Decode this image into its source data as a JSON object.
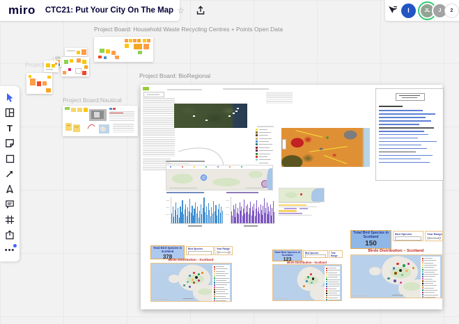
{
  "header": {
    "logo_text": "miro",
    "board_title": "CTC21: Put Your City On The Map",
    "presence_count": "2",
    "avatars": [
      {
        "initials": "I"
      },
      {
        "initials": "JL"
      },
      {
        "initials": "J"
      }
    ]
  },
  "toolbar": {
    "items": [
      "select",
      "templates",
      "text",
      "sticky-note",
      "shape",
      "connection-line",
      "pen",
      "comment",
      "frame",
      "upload",
      "more"
    ]
  },
  "canvas_labels": {
    "household": "Project Board: Household Waste Recycling Centres + Points Open Data",
    "bioregional": "Project Board: BioRegional",
    "nautical": "Project Board:Nautical",
    "ghost": "Project Board:"
  },
  "bird_dashboards": [
    {
      "header": "Total Bird Species in Scotland",
      "count": "378",
      "species_filter": "Bird Species",
      "year_filter": "Year Range",
      "title": "Birds Distribution - Scotland"
    },
    {
      "header": "Total Bird Species in Scotland",
      "count": "123",
      "species_filter": "Bird Species",
      "year_filter": "Year Range",
      "title": "Birds Distribution - Scotland"
    },
    {
      "header": "Total Bird Species in Scotland",
      "count": "150",
      "species_filter": "Bird Species",
      "year_filter": "Year Range",
      "title": "Birds Distribution – Scotland"
    }
  ],
  "charts": {
    "blue_bars": [
      38,
      62,
      25,
      50,
      78,
      32,
      57,
      20,
      64,
      42,
      88,
      35,
      52,
      72,
      27,
      60,
      44,
      92,
      40,
      67,
      30,
      54,
      80,
      37,
      62,
      22,
      47,
      70,
      34,
      57,
      97,
      42,
      64,
      32,
      77,
      50,
      27,
      60,
      38,
      84,
      46,
      68,
      30,
      52,
      74,
      40,
      62,
      47
    ],
    "purple_bars": [
      45,
      30,
      68,
      52,
      25,
      74,
      40,
      58,
      33,
      80,
      47,
      62,
      28,
      55,
      90,
      38,
      65,
      42,
      70,
      35,
      58,
      82,
      30,
      62,
      48,
      75,
      27,
      54,
      86,
      44,
      60,
      37,
      72,
      50,
      32,
      66,
      95,
      40,
      57,
      78,
      35,
      63,
      46,
      70,
      29,
      58,
      83,
      41
    ]
  },
  "links_doc": {
    "line_widths": [
      66,
      84,
      70,
      78,
      60,
      82,
      68,
      74,
      58,
      86,
      64,
      72,
      55,
      80,
      62,
      76
    ]
  },
  "colors": {
    "miro_blue": "#4262ff",
    "avatar_blue": "#2254c4",
    "avatar_sage": "#93a393",
    "avatar_gray": "#a3a3a3",
    "soil_legend": [
      "#f3e23a",
      "#8a6b3d",
      "#55401f",
      "#caa96a",
      "#4a90d9",
      "#2e7d6e",
      "#8b1a1a",
      "#6d1f4e",
      "#2e8b2e",
      "#d93025",
      "#9ad1e8",
      "#f5f5f5"
    ],
    "bird_legend": [
      "#d73027",
      "#f46d43",
      "#fdae61",
      "#fee08b",
      "#a6d96a",
      "#1a9850",
      "#66c2a5",
      "#3288bd",
      "#5e4fa2",
      "#d63a8e",
      "#8c510a",
      "#000000",
      "#807d6f",
      "#e08214",
      "#35978f",
      "#c51b7d",
      "#4575b4",
      "#8073ac"
    ],
    "sticky_palette": [
      "#fac710",
      "#ff9d48",
      "#f24726",
      "#8fd14f",
      "#4a90d9",
      "#e91e63"
    ]
  }
}
